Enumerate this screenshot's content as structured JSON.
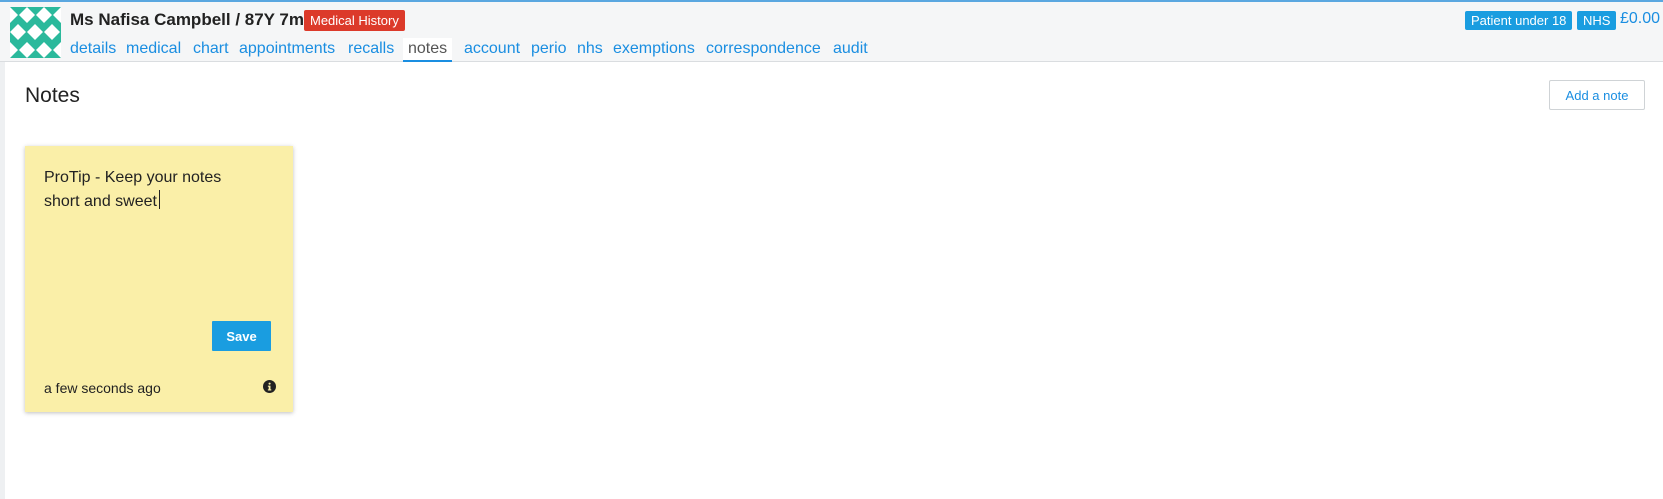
{
  "header": {
    "patient_name": "Ms Nafisa Campbell / 87Y 7m",
    "medical_history_badge": "Medical History",
    "tabs": [
      {
        "label": "details"
      },
      {
        "label": "medical"
      },
      {
        "label": "chart"
      },
      {
        "label": "appointments"
      },
      {
        "label": "recalls"
      },
      {
        "label": "notes",
        "active": true
      },
      {
        "label": "account"
      },
      {
        "label": "perio"
      },
      {
        "label": "nhs"
      },
      {
        "label": "exemptions"
      },
      {
        "label": "correspondence"
      },
      {
        "label": "audit"
      }
    ],
    "badges": {
      "under18": "Patient under 18",
      "nhs": "NHS"
    },
    "balance": "£0.00"
  },
  "main": {
    "title": "Notes",
    "add_note_label": "Add a note",
    "note": {
      "text_line1": "ProTip - Keep your notes",
      "text_line2": "short and sweet",
      "save_label": "Save",
      "timestamp": "a few seconds ago"
    }
  },
  "colors": {
    "accent": "#1a8ee1",
    "badge_red": "#dc3a2a",
    "note_bg": "#faefa8",
    "avatar": "#2bb99c"
  },
  "icons": {
    "avatar": "patient-avatar",
    "info": "info-icon"
  }
}
